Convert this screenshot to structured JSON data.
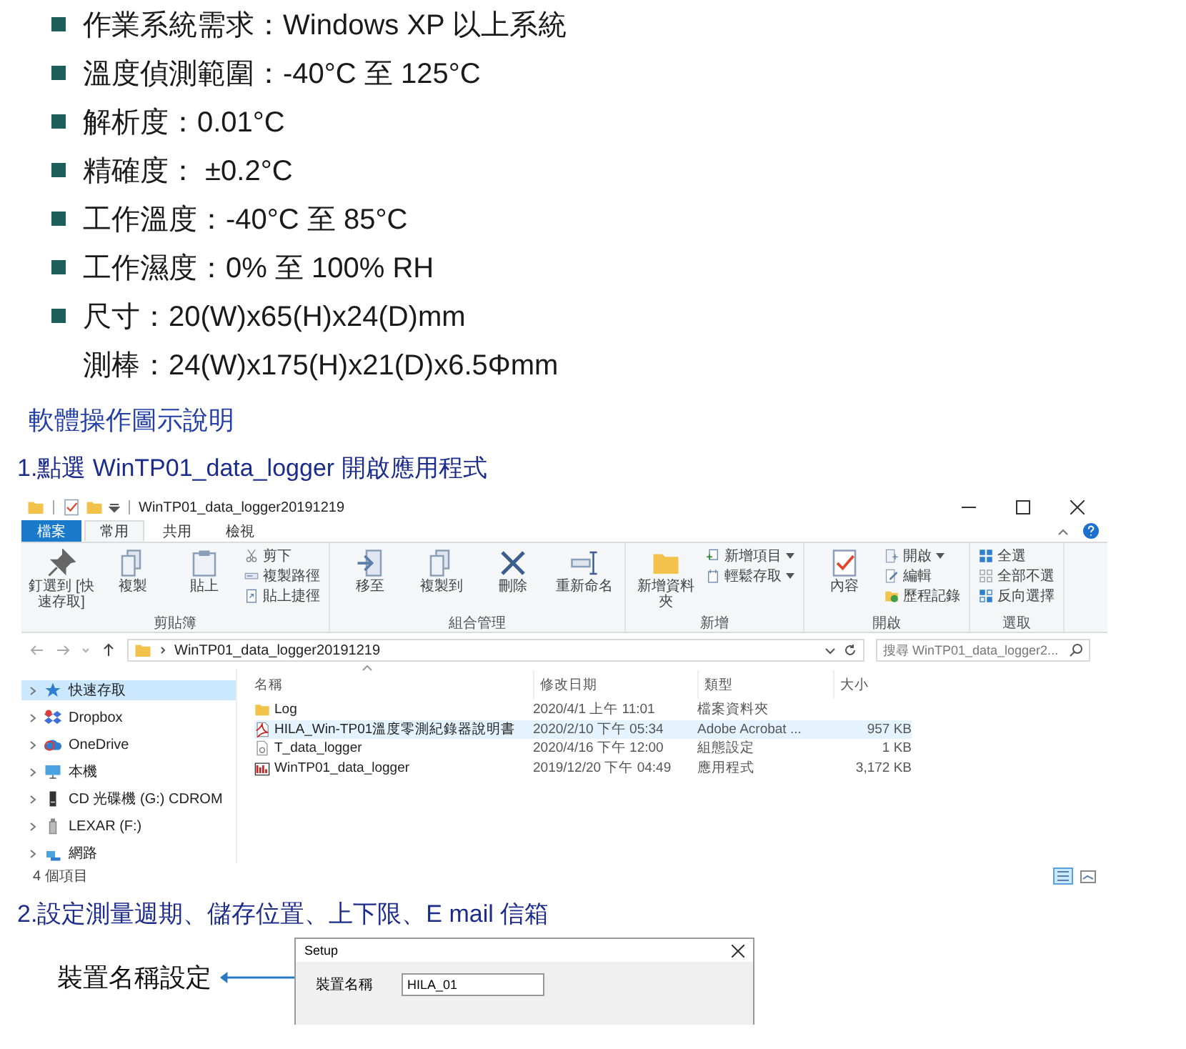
{
  "specs": [
    {
      "text": "作業系統需求：Windows XP  以上系統",
      "kind": "bullet"
    },
    {
      "text": "溫度偵測範圍：-40°C 至 125°C",
      "kind": "bullet"
    },
    {
      "text": "解析度：0.01°C",
      "kind": "bullet"
    },
    {
      "text": "精確度： ±0.2°C",
      "kind": "bullet"
    },
    {
      "text": "工作溫度：-40°C 至 85°C",
      "kind": "bullet"
    },
    {
      "text": "工作濕度：0%  至 100% RH",
      "kind": "bullet"
    },
    {
      "text": "尺寸：20(W)x65(H)x24(D)mm",
      "kind": "bullet"
    },
    {
      "text": "測棒：24(W)x175(H)x21(D)x6.5Φmm",
      "kind": "continuation"
    }
  ],
  "section_title": "軟體操作圖示說明",
  "step_1": "1.點選 WinTP01_data_logger 開啟應用程式",
  "explorer": {
    "title": "WinTP01_data_logger20191219",
    "tabs": [
      {
        "label": "檔案",
        "kind": "file",
        "selected": false
      },
      {
        "label": "常用",
        "kind": "tab",
        "selected": true
      },
      {
        "label": "共用",
        "kind": "tab",
        "selected": false
      },
      {
        "label": "檢視",
        "kind": "tab",
        "selected": false
      }
    ],
    "ribbon": [
      {
        "label": "剪貼簿",
        "large": [
          {
            "label": "釘選到 [快速存取]",
            "kind": "pin"
          },
          {
            "label": "複製",
            "kind": "copy"
          },
          {
            "label": "貼上",
            "kind": "paste"
          }
        ],
        "small": [
          {
            "label": "剪下",
            "kind": "cut",
            "menu": false
          },
          {
            "label": "複製路徑",
            "kind": "path",
            "menu": false
          },
          {
            "label": "貼上捷徑",
            "kind": "shortcut",
            "menu": false
          }
        ]
      },
      {
        "label": "組合管理",
        "large": [
          {
            "label": "移至",
            "kind": "move"
          },
          {
            "label": "複製到",
            "kind": "copy"
          },
          {
            "label": "刪除",
            "kind": "delete"
          },
          {
            "label": "重新命名",
            "kind": "rename"
          }
        ]
      },
      {
        "label": "新增",
        "large": [
          {
            "label": "新增資料夾",
            "kind": "folder"
          }
        ],
        "small": [
          {
            "label": "新增項目",
            "kind": "newitem",
            "menu": true
          },
          {
            "label": "輕鬆存取",
            "kind": "easy",
            "menu": true
          }
        ]
      },
      {
        "label": "開啟",
        "large": [
          {
            "label": "內容",
            "kind": "props"
          }
        ],
        "small": [
          {
            "label": "開啟",
            "kind": "open",
            "menu": true
          },
          {
            "label": "編輯",
            "kind": "edit",
            "menu": false
          },
          {
            "label": "歷程記錄",
            "kind": "history",
            "menu": false
          }
        ]
      },
      {
        "label": "選取",
        "small": [
          {
            "label": "全選",
            "kind": "selall",
            "menu": false
          },
          {
            "label": "全部不選",
            "kind": "selnone",
            "menu": false
          },
          {
            "label": "反向選擇",
            "kind": "invert",
            "menu": false
          }
        ]
      }
    ],
    "address": "WinTP01_data_logger20191219",
    "search_placeholder": "搜尋 WinTP01_data_logger2...",
    "nav": [
      {
        "label": "快速存取",
        "kind": "star",
        "selected": true
      },
      {
        "label": "Dropbox",
        "kind": "dropbox",
        "selected": false
      },
      {
        "label": "OneDrive",
        "kind": "onedrive",
        "selected": false
      },
      {
        "label": "本機",
        "kind": "pc",
        "selected": false
      },
      {
        "label": "CD 光碟機 (G:) CDROM",
        "kind": "cd",
        "selected": false
      },
      {
        "label": "LEXAR (F:)",
        "kind": "usb",
        "selected": false
      },
      {
        "label": "網路",
        "kind": "net",
        "selected": false
      }
    ],
    "columns": [
      "名稱",
      "修改日期",
      "類型",
      "大小"
    ],
    "files": [
      {
        "name": "Log",
        "date": "2020/4/1 上午 11:01",
        "type": "檔案資料夾",
        "kind": "folder",
        "selected": false
      },
      {
        "name": "HILA_Win-TP01溫度零測紀錄器說明書",
        "date": "2020/2/10 下午 05:34",
        "type": "Adobe Acrobat ...",
        "size": "957 KB",
        "kind": "pdf",
        "selected": true
      },
      {
        "name": "T_data_logger",
        "date": "2020/4/16 下午 12:00",
        "type": "組態設定",
        "size": "1 KB",
        "kind": "config",
        "selected": false
      },
      {
        "name": "WinTP01_data_logger",
        "date": "2019/12/20 下午 04:49",
        "type": "應用程式",
        "size": "3,172 KB",
        "kind": "app",
        "selected": false
      }
    ],
    "status": "4 個項目"
  },
  "step_2": "2.設定測量週期、儲存位置、上下限、E mail 信箱",
  "setup": {
    "title": "Setup",
    "fields": [
      {
        "label": "裝置名稱",
        "value": "HILA_01"
      }
    ],
    "callouts": [
      "裝置名稱設定"
    ]
  }
}
